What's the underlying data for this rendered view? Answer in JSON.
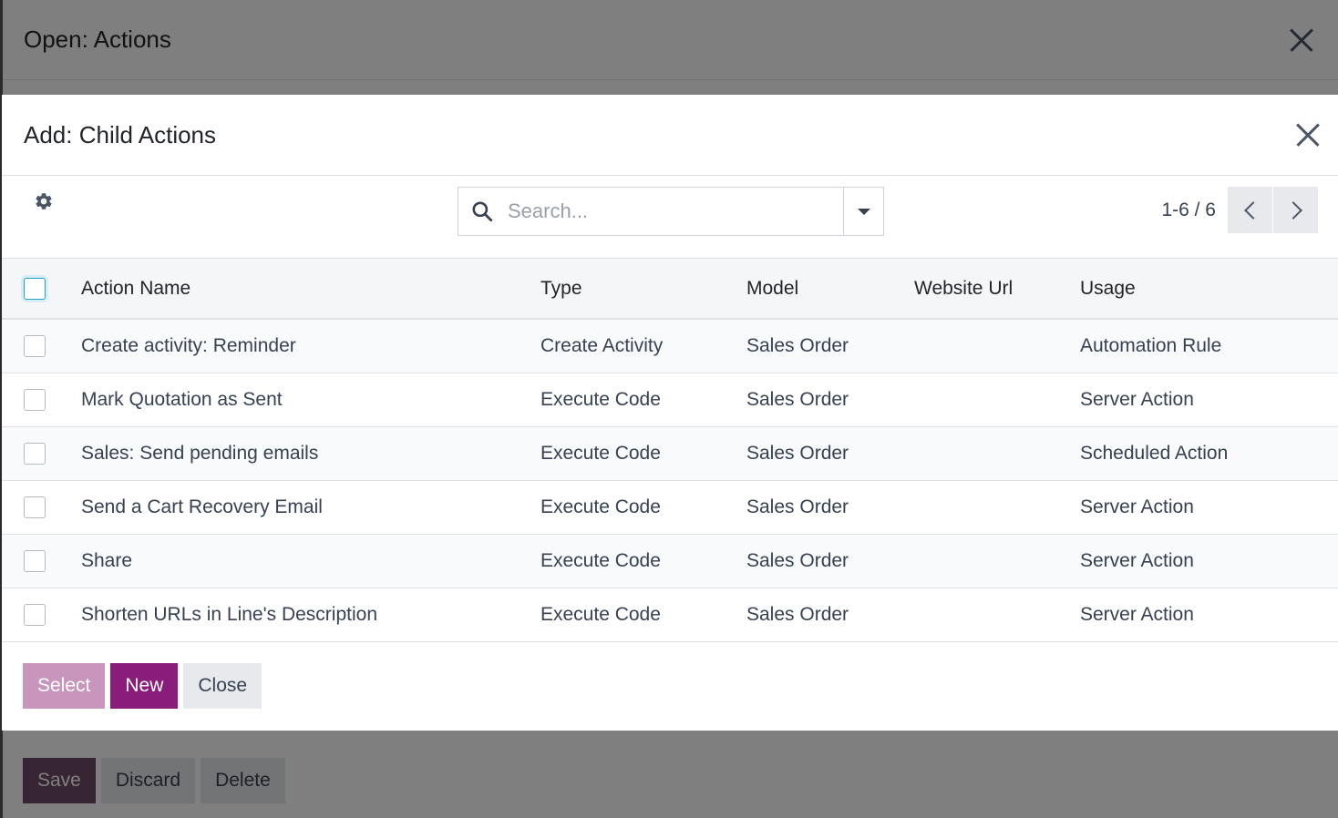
{
  "background_dialog": {
    "title": "Open: Actions",
    "footer": {
      "save_label": "Save",
      "discard_label": "Discard",
      "delete_label": "Delete"
    }
  },
  "dialog": {
    "title": "Add: Child Actions",
    "search": {
      "placeholder": "Search..."
    },
    "pager": {
      "value": "1-6 / 6"
    },
    "columns": {
      "action_name": "Action Name",
      "type": "Type",
      "model": "Model",
      "website_url": "Website Url",
      "usage": "Usage"
    },
    "rows": [
      {
        "name": "Create activity: Reminder",
        "type": "Create Activity",
        "model": "Sales Order",
        "website_url": "",
        "usage": "Automation Rule"
      },
      {
        "name": "Mark Quotation as Sent",
        "type": "Execute Code",
        "model": "Sales Order",
        "website_url": "",
        "usage": "Server Action"
      },
      {
        "name": "Sales: Send pending emails",
        "type": "Execute Code",
        "model": "Sales Order",
        "website_url": "",
        "usage": "Scheduled Action"
      },
      {
        "name": "Send a Cart Recovery Email",
        "type": "Execute Code",
        "model": "Sales Order",
        "website_url": "",
        "usage": "Server Action"
      },
      {
        "name": "Share",
        "type": "Execute Code",
        "model": "Sales Order",
        "website_url": "",
        "usage": "Server Action"
      },
      {
        "name": "Shorten URLs in Line's Description",
        "type": "Execute Code",
        "model": "Sales Order",
        "website_url": "",
        "usage": "Server Action"
      }
    ],
    "footer": {
      "select_label": "Select",
      "new_label": "New",
      "close_label": "Close"
    }
  },
  "icons": {
    "close": "close-icon",
    "settings": "gear-icon",
    "search": "search-icon",
    "toggle": "caret-down-icon",
    "prev": "chevron-left-icon",
    "next": "chevron-right-icon"
  },
  "colors": {
    "primary": "#714b67",
    "primary_new": "#8a1c7c",
    "select_disabled": "#c895bd",
    "overlay": "rgba(0,0,0,0.5)"
  }
}
